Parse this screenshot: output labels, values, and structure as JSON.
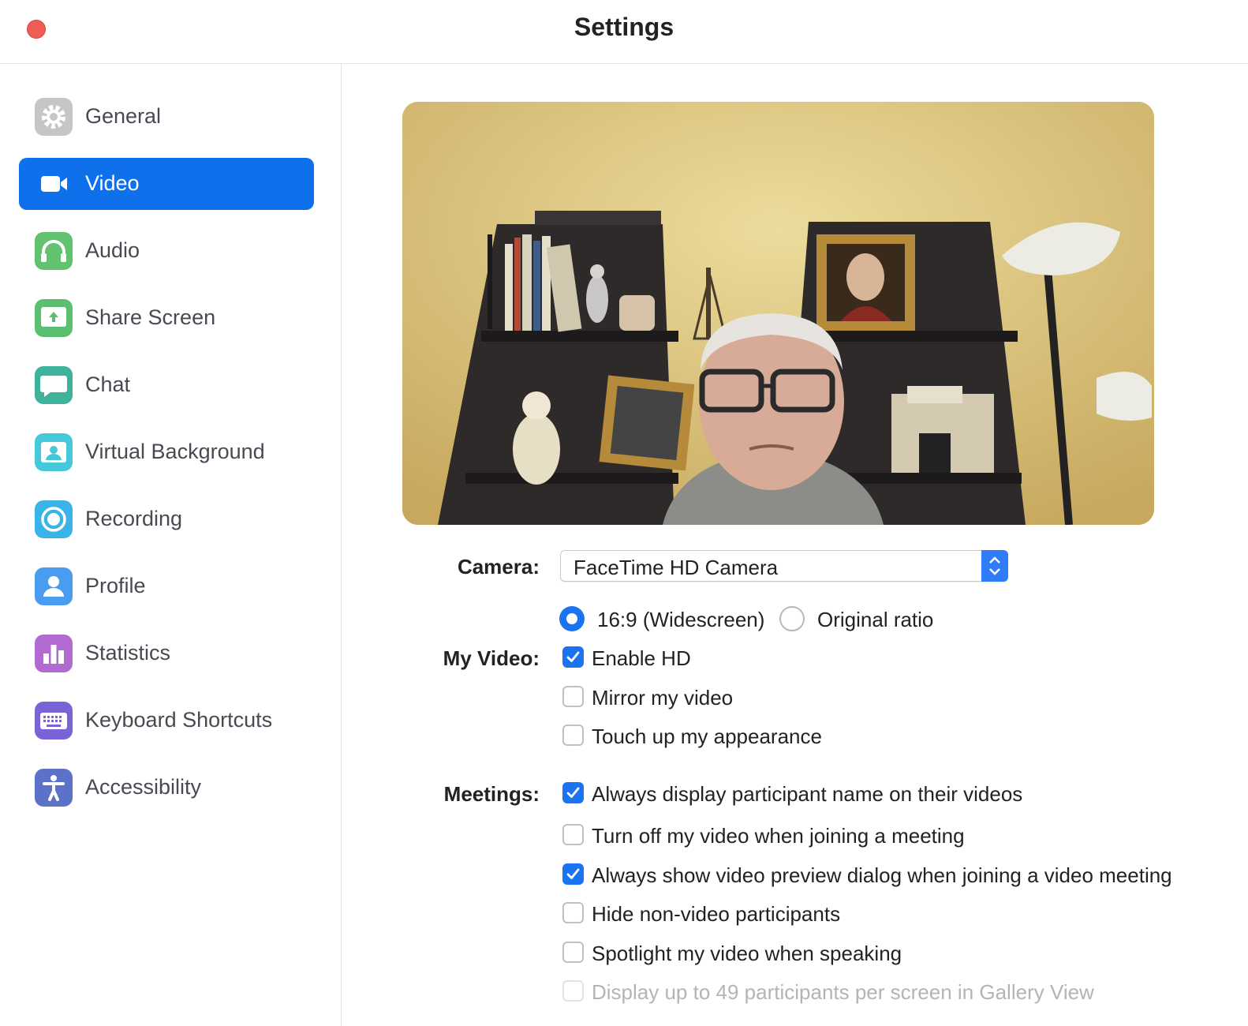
{
  "window": {
    "title": "Settings"
  },
  "sidebar": {
    "items": [
      {
        "label": "General",
        "icon": "gear-icon",
        "color": "#c6c6c6",
        "active": false
      },
      {
        "label": "Video",
        "icon": "video-camera-icon",
        "color": "#0e71eb",
        "active": true
      },
      {
        "label": "Audio",
        "icon": "headphones-icon",
        "color": "#63c26f",
        "active": false
      },
      {
        "label": "Share Screen",
        "icon": "share-screen-icon",
        "color": "#5bbf71",
        "active": false
      },
      {
        "label": "Chat",
        "icon": "chat-bubble-icon",
        "color": "#3fb29c",
        "active": false
      },
      {
        "label": "Virtual Background",
        "icon": "person-portrait-icon",
        "color": "#45c8da",
        "active": false
      },
      {
        "label": "Recording",
        "icon": "record-icon",
        "color": "#3ab4e8",
        "active": false
      },
      {
        "label": "Profile",
        "icon": "user-icon",
        "color": "#4a9cf0",
        "active": false
      },
      {
        "label": "Statistics",
        "icon": "bar-chart-icon",
        "color": "#b16ad0",
        "active": false
      },
      {
        "label": "Keyboard Shortcuts",
        "icon": "keyboard-icon",
        "color": "#7a63d6",
        "active": false
      },
      {
        "label": "Accessibility",
        "icon": "accessibility-icon",
        "color": "#5c71c8",
        "active": false
      }
    ]
  },
  "camera": {
    "label": "Camera:",
    "selected": "FaceTime HD Camera"
  },
  "aspect": {
    "options": [
      {
        "label": "16:9 (Widescreen)",
        "selected": true
      },
      {
        "label": "Original ratio",
        "selected": false
      }
    ]
  },
  "my_video": {
    "label": "My Video:",
    "options": [
      {
        "label": "Enable HD",
        "checked": true,
        "disabled": false
      },
      {
        "label": "Mirror my video",
        "checked": false,
        "disabled": false
      },
      {
        "label": "Touch up my appearance",
        "checked": false,
        "disabled": false
      }
    ]
  },
  "meetings": {
    "label": "Meetings:",
    "options": [
      {
        "label": "Always display participant name on their videos",
        "checked": true,
        "disabled": false
      },
      {
        "label": "Turn off my video when joining a meeting",
        "checked": false,
        "disabled": false
      },
      {
        "label": "Always show video preview dialog when joining a video meeting",
        "checked": true,
        "disabled": false
      },
      {
        "label": "Hide non-video participants",
        "checked": false,
        "disabled": false
      },
      {
        "label": "Spotlight my video when speaking",
        "checked": false,
        "disabled": false
      },
      {
        "label": "Display up to 49 participants per screen in Gallery View",
        "checked": false,
        "disabled": true
      }
    ]
  },
  "colors": {
    "accent": "#0e71eb",
    "close_button": "#ee5e56"
  }
}
